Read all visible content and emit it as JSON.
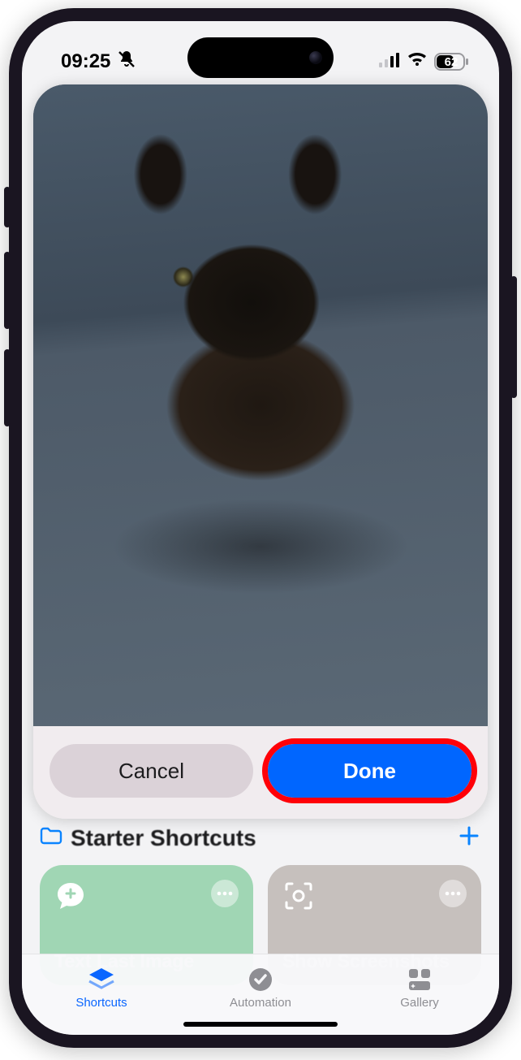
{
  "status_bar": {
    "time": "09:25",
    "silent_icon": "bell-slash",
    "battery_percent": "62"
  },
  "preview": {
    "subject": "black-cat-photo",
    "cancel_label": "Cancel",
    "done_label": "Done"
  },
  "section": {
    "title": "Starter Shortcuts",
    "add_icon": "plus"
  },
  "cards": [
    {
      "label": "Text Last Image",
      "icon": "chat-plus",
      "color": "#a0d6b4"
    },
    {
      "label": "Show Screenshots",
      "icon": "viewfinder-camera",
      "color": "#c6c0bd"
    }
  ],
  "tabs": [
    {
      "label": "Shortcuts",
      "icon": "layers",
      "active": true
    },
    {
      "label": "Automation",
      "icon": "clock-check",
      "active": false
    },
    {
      "label": "Gallery",
      "icon": "sparkle-grid",
      "active": false
    }
  ],
  "highlight": {
    "target": "done-button",
    "color": "#ff0008"
  }
}
